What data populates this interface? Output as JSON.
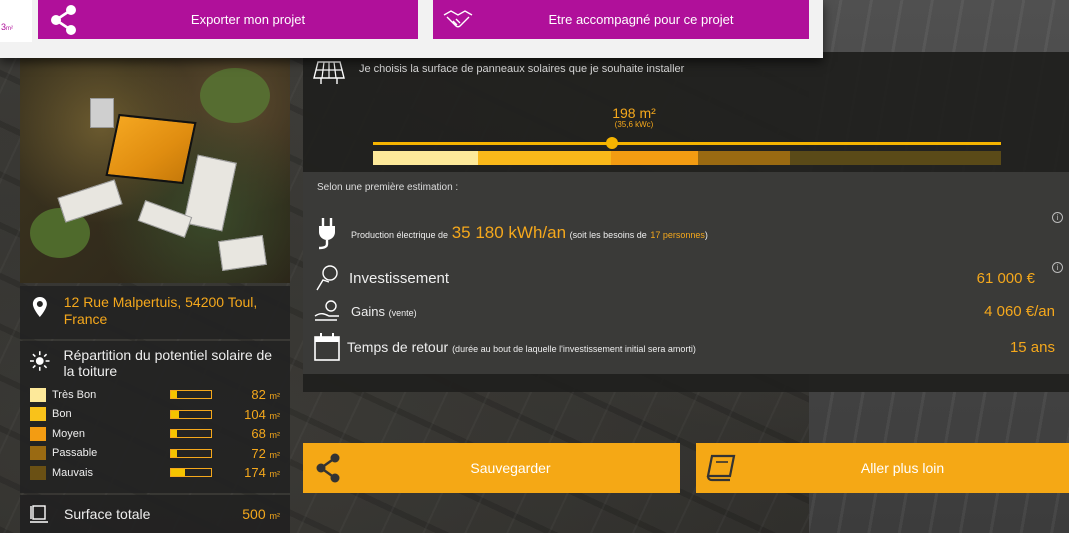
{
  "popup": {
    "stub_value": "3",
    "stub_unit": "m²",
    "export_label": "Exporter mon projet",
    "accompany_label": "Etre accompagné pour ce projet"
  },
  "sidebar": {
    "address": "12 Rue Malpertuis, 54200 Toul, France",
    "repartition_title": "Répartition du potentiel solaire de la toiture",
    "unit": "m²",
    "legend": [
      {
        "label": "Très Bon",
        "value": "82",
        "color": "#fde99a",
        "fraction": 0.16
      },
      {
        "label": "Bon",
        "value": "104",
        "color": "#f9c21a",
        "fraction": 0.21
      },
      {
        "label": "Moyen",
        "value": "68",
        "color": "#f39c12",
        "fraction": 0.14
      },
      {
        "label": "Passable",
        "value": "72",
        "color": "#9a6a12",
        "fraction": 0.14
      },
      {
        "label": "Mauvais",
        "value": "174",
        "color": "#6a5014",
        "fraction": 0.35
      }
    ],
    "total_label": "Surface totale",
    "total_value": "500"
  },
  "main": {
    "surface_text": "Je choisis la surface de panneaux solaires que je souhaite installer",
    "slider_value": "198 m²",
    "slider_sub": "(35,6 kWc)",
    "slider_fraction": 0.38,
    "estimation_head": "Selon une première estimation :",
    "production_prefix": "Production électrique de",
    "production_value": "35 180 kWh/an",
    "production_suffix_1": "(soit les besoins de",
    "production_people": "17 personnes",
    "production_suffix_2": ")",
    "investment_label": "Investissement",
    "investment_value": "61 000 €",
    "gains_label": "Gains",
    "gains_sub": "(vente)",
    "gains_value": "4 060 €/an",
    "return_label": "Temps de retour",
    "return_sub": "(durée au bout de laquelle l'investissement initial sera amorti)",
    "return_value": "15 ans",
    "info_glyph": "i"
  },
  "buttons": {
    "save_label": "Sauvegarder",
    "more_label": "Aller plus loin"
  },
  "colors": {
    "accent": "#f5a81c",
    "magenta": "#b0109a"
  }
}
